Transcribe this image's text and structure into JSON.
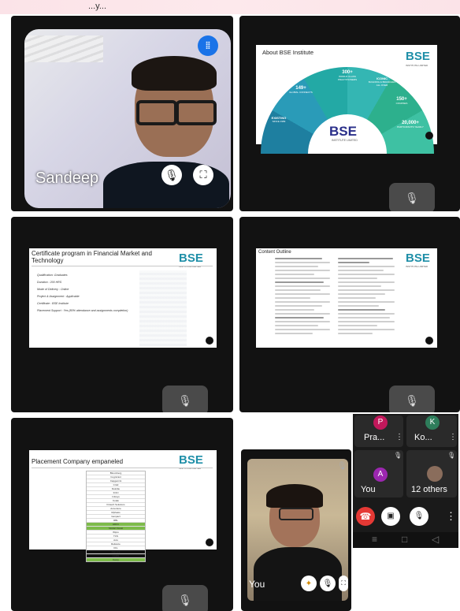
{
  "top_banner": {
    "text": "...y..."
  },
  "participant": {
    "name": "Sandeep"
  },
  "slide_about": {
    "title": "About BSE Institute",
    "stats": [
      {
        "value": "300+",
        "label": "WORLD CLASS PRACTITIONERS"
      },
      {
        "value": "149+",
        "label": "GLOBAL CONNECTS"
      },
      {
        "value": "EXISTING",
        "label": "SINCE 1989"
      },
      {
        "value": "ICONIC",
        "label": "BUILDING & BRANCHES ALL OVER"
      },
      {
        "value": "150+",
        "label": "COURSES"
      },
      {
        "value": "20,000+",
        "label": "PARTICIPANTS YEARLY"
      }
    ],
    "logo_main": "BSE",
    "logo_sub": "INSTITUTE LIMITED"
  },
  "slide_cert": {
    "title": "Certificate program in Financial Market and Technology",
    "lines": [
      "Qualification: Graduates",
      "Duration : 200 HRS",
      "Mode of Delivery : Online",
      "Project & Assignment : Applicable",
      "Certificate : BSE Institute",
      "Placement Support : Yes (80% attendance and assignments completion)"
    ]
  },
  "slide_content": {
    "title": "Content Outline"
  },
  "slide_placement": {
    "title": "Placement Company empaneled",
    "companies": [
      "Bloomberg",
      "Cognizant",
      "Capgemini",
      "Crisil",
      "Deloitte",
      "ICICI",
      "Infosys",
      "Kotak",
      "Fintech Solutions",
      "Accenture",
      "Mphasis",
      "Genpact",
      "RBL",
      "HDFC",
      "Motilal Oswal",
      "Wipro",
      "TCS",
      "Axis",
      "Reliance",
      "IIFL",
      "Nomura",
      "CAMS",
      "Karvy"
    ]
  },
  "logo": {
    "main": "BSE",
    "sub": "INSTITUTE LIMITED"
  },
  "self": {
    "label": "You"
  },
  "side_panel": {
    "people": [
      {
        "initial": "P",
        "name": "Pra...",
        "color": "#c2185b"
      },
      {
        "initial": "K",
        "name": "Ko...",
        "color": "#2e7d5b"
      },
      {
        "initial": "A",
        "name": "You",
        "color": "#9c27b0"
      },
      {
        "initial": "",
        "name": "12 others",
        "color": "#8a6d5c"
      }
    ],
    "nav_buttons": [
      "≡",
      "□",
      "◁"
    ]
  },
  "colors": {
    "end_call": "#e53935",
    "tile_bg": "#121212",
    "muted_bg": "#4a4a4a",
    "brand": "#2a2f8a"
  }
}
